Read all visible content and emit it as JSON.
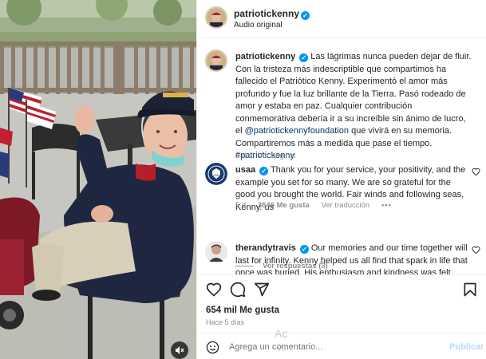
{
  "photo": {
    "alt": "Man in veteran cap waving with American flags",
    "mute_icon": "speaker-muted-icon"
  },
  "header": {
    "username": "patriotickenny",
    "verified": true,
    "subtitle": "Audio original"
  },
  "caption": {
    "username": "patriotickenny",
    "text_before": "Las lágrimas nunca pueden dejar de fluir. Con la tristeza más indescriptible que compartimos ha fallecido el Patriótico Kenny. Experimentó el amor más profundo y fue la luz brillante de la Tierra. Pasó rodeado de amor y estaba en paz. Cualquier contribución conmemorativa debería ir a su increíble sin ánimo de lucro, el ",
    "mention": "@patriotickennyfoundation",
    "text_after": " que vivirá en su memoria. Compartiremos más a medida que pase el tiempo.",
    "hashtag": "#patriotickenny",
    "age": "5 d",
    "translation_link": "Ver original"
  },
  "comments": [
    {
      "username": "usaa",
      "text": "Thank you for your service, your positivity, and the example you set for so many. We are so grateful for the good you brought the world. Fair winds and following seas, Kenny. us",
      "age": "5 d",
      "likes": "3646 Me gusta",
      "translation_link": "Ver traducción",
      "more": "•••",
      "replies": "Ver respuestas (3)"
    },
    {
      "username": "therandytravis",
      "text": "Our memories and our time together will last for infinity. Kenny helped us all find that spark in life that once was buried. His enthusiasm and kindness was felt around the"
    }
  ],
  "actions": {
    "likes": "654 mil Me gusta",
    "time_ago": "Hace 5 días",
    "icons": [
      "heart-icon",
      "comment-icon",
      "share-icon",
      "bookmark-icon"
    ]
  },
  "composer": {
    "placeholder": "Agrega un comentario...",
    "publish": "Publicar"
  },
  "watermark": {
    "line1": "Ac",
    "line2": "Ve"
  },
  "colors": {
    "accent": "#0095f6",
    "link": "#00376b",
    "muted": "#8e8e8e",
    "publish_disabled": "#b3dbff"
  }
}
